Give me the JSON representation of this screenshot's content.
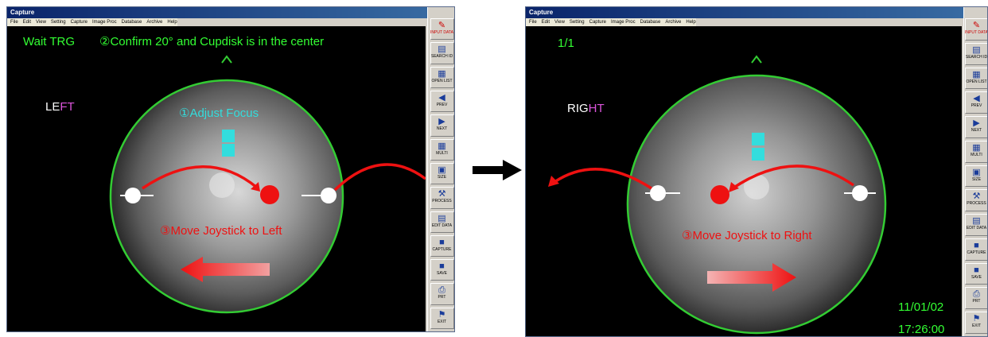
{
  "left_window": {
    "title": "Capture",
    "menu": [
      "File",
      "Edit",
      "View",
      "Setting",
      "Capture",
      "Image Proc",
      "Database",
      "Archive",
      "Help"
    ],
    "status": "Wait TRG",
    "instruction_confirm": "②Confirm  20°  and  Cupdisk is in the center",
    "eye_label_prefix": "LE",
    "eye_label_suffix": "FT",
    "instruction_focus": "①Adjust Focus",
    "instruction_move": "③Move Joystick to Left",
    "toolbar": [
      {
        "icon": "pen-icon",
        "glyph": "✎",
        "label": "INPUT DATA",
        "red": true
      },
      {
        "icon": "search-id-icon",
        "glyph": "▤",
        "label": "SEARCH ID",
        "red": false
      },
      {
        "icon": "open-list-icon",
        "glyph": "▦",
        "label": "OPEN LIST",
        "red": false
      },
      {
        "icon": "prev-icon",
        "glyph": "◀",
        "label": "PREV",
        "red": false
      },
      {
        "icon": "next-icon",
        "glyph": "▶",
        "label": "NEXT",
        "red": false
      },
      {
        "icon": "multi-icon",
        "glyph": "▦",
        "label": "MULTI",
        "red": false
      },
      {
        "icon": "size-icon",
        "glyph": "▣",
        "label": "SIZE",
        "red": false
      },
      {
        "icon": "process-icon",
        "glyph": "⚒",
        "label": "PROCESS",
        "red": false
      },
      {
        "icon": "edit-data-icon",
        "glyph": "▤",
        "label": "EDIT DATA",
        "red": false
      },
      {
        "icon": "camera-icon",
        "glyph": "■",
        "label": "CAPTURE",
        "red": false
      },
      {
        "icon": "save-icon",
        "glyph": "■",
        "label": "SAVE",
        "red": false
      },
      {
        "icon": "print-icon",
        "glyph": "⎙",
        "label": "PRT",
        "red": false
      },
      {
        "icon": "exit-icon",
        "glyph": "⚑",
        "label": "EXIT",
        "red": false
      }
    ]
  },
  "right_window": {
    "title": "Capture",
    "menu": [
      "File",
      "Edit",
      "View",
      "Setting",
      "Capture",
      "Image Proc",
      "Database",
      "Archive",
      "Help"
    ],
    "counter": "1/1",
    "eye_label_prefix": "RIG",
    "eye_label_suffix": "HT",
    "instruction_move": "③Move Joystick to Right",
    "date": "11/01/02",
    "time": "17:26:00",
    "toolbar": [
      {
        "icon": "pen-icon",
        "glyph": "✎",
        "label": "INPUT DATA",
        "red": true
      },
      {
        "icon": "search-id-icon",
        "glyph": "▤",
        "label": "SEARCH ID",
        "red": false
      },
      {
        "icon": "open-list-icon",
        "glyph": "▦",
        "label": "OPEN LIST",
        "red": false
      },
      {
        "icon": "prev-icon",
        "glyph": "◀",
        "label": "PREV",
        "red": false
      },
      {
        "icon": "next-icon",
        "glyph": "▶",
        "label": "NEXT",
        "red": false
      },
      {
        "icon": "multi-icon",
        "glyph": "▦",
        "label": "MULTI",
        "red": false
      },
      {
        "icon": "size-icon",
        "glyph": "▣",
        "label": "SIZE",
        "red": false
      },
      {
        "icon": "process-icon",
        "glyph": "⚒",
        "label": "PROCESS",
        "red": false
      },
      {
        "icon": "edit-data-icon",
        "glyph": "▤",
        "label": "EDIT DATA",
        "red": false
      },
      {
        "icon": "camera-icon",
        "glyph": "■",
        "label": "CAPTURE",
        "red": false
      },
      {
        "icon": "save-icon",
        "glyph": "■",
        "label": "SAVE",
        "red": false
      },
      {
        "icon": "print-icon",
        "glyph": "⎙",
        "label": "PRT",
        "red": false
      },
      {
        "icon": "exit-icon",
        "glyph": "⚑",
        "label": "EXIT",
        "red": false
      }
    ]
  },
  "colors": {
    "fundus_ring": "#33cc33",
    "instruction_green": "#33ff33",
    "focus_cyan": "#33dddd",
    "marker_red": "#ee1111",
    "label_white": "#ffffff",
    "label_pink": "#dd55dd"
  }
}
